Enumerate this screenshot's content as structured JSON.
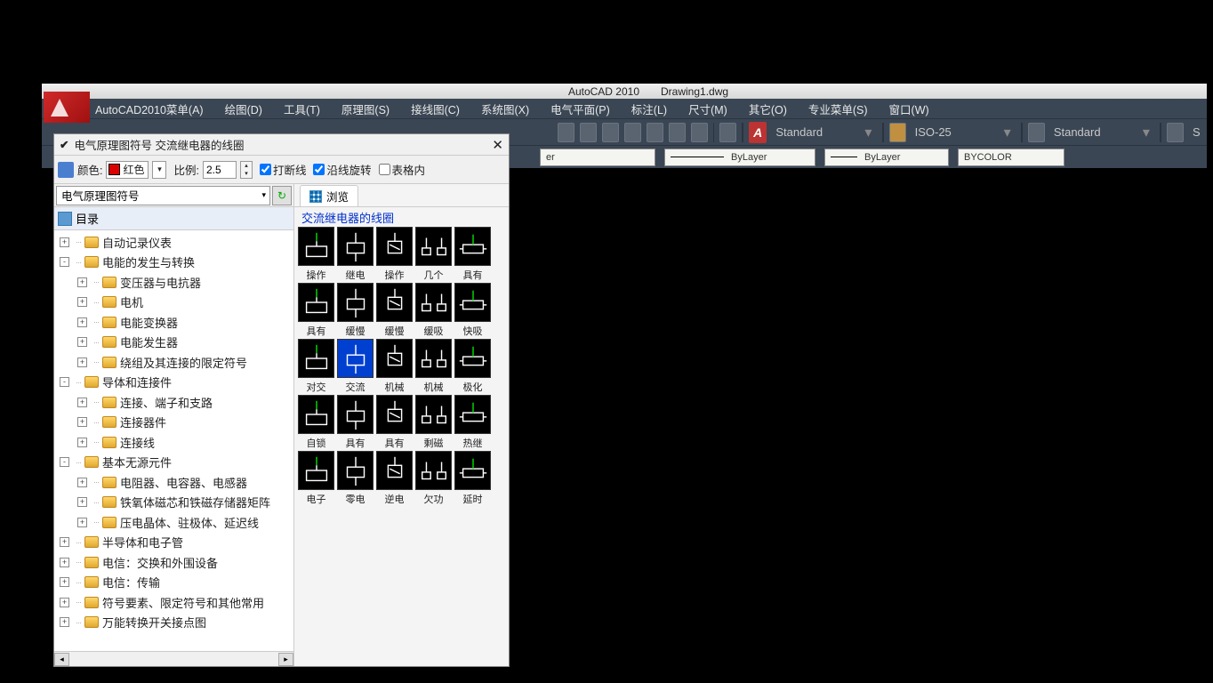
{
  "title_bar": {
    "app_name": "AutoCAD 2010",
    "file_name": "Drawing1.dwg"
  },
  "menu": {
    "m0": "AutoCAD2010菜单(A)",
    "m1": "绘图(D)",
    "m2": "工具(T)",
    "m3": "原理图(S)",
    "m4": "接线图(C)",
    "m5": "系统图(X)",
    "m6": "电气平面(P)",
    "m7": "标注(L)",
    "m8": "尺寸(M)",
    "m9": "其它(O)",
    "m10": "专业菜单(S)",
    "m11": "窗口(W)"
  },
  "ribbon": {
    "annot_letter": "A",
    "style1": "Standard",
    "style2": "ISO-25",
    "style3": "Standard",
    "style4": "S",
    "prop1_suffix": "er",
    "prop2": "ByLayer",
    "prop3": "ByLayer",
    "prop4": "BYCOLOR"
  },
  "panel": {
    "title": "电气原理图符号 交流继电器的线圈",
    "color_label": "颜色:",
    "color_text": "红色",
    "scale_label": "比例:",
    "scale_value": "2.5",
    "chk1": "打断线",
    "chk2": "沿线旋转",
    "chk3": "表格内",
    "combo": "电气原理图符号",
    "root": "目录",
    "tab_browse": "浏览",
    "preview_title": "交流继电器的线圈"
  },
  "tree": [
    {
      "depth": 1,
      "exp": "+",
      "label": "自动记录仪表"
    },
    {
      "depth": 1,
      "exp": "-",
      "label": "电能的发生与转换"
    },
    {
      "depth": 2,
      "exp": "+",
      "label": "变压器与电抗器"
    },
    {
      "depth": 2,
      "exp": "+",
      "label": "电机"
    },
    {
      "depth": 2,
      "exp": "+",
      "label": "电能变换器"
    },
    {
      "depth": 2,
      "exp": "+",
      "label": "电能发生器"
    },
    {
      "depth": 2,
      "exp": "+",
      "label": "绕组及其连接的限定符号"
    },
    {
      "depth": 1,
      "exp": "-",
      "label": "导体和连接件"
    },
    {
      "depth": 2,
      "exp": "+",
      "label": "连接、端子和支路"
    },
    {
      "depth": 2,
      "exp": "+",
      "label": "连接器件"
    },
    {
      "depth": 2,
      "exp": "+",
      "label": "连接线"
    },
    {
      "depth": 1,
      "exp": "-",
      "label": "基本无源元件"
    },
    {
      "depth": 2,
      "exp": "+",
      "label": "电阻器、电容器、电感器"
    },
    {
      "depth": 2,
      "exp": "+",
      "label": "铁氧体磁芯和铁磁存储器矩阵"
    },
    {
      "depth": 2,
      "exp": "+",
      "label": "压电晶体、驻极体、延迟线"
    },
    {
      "depth": 1,
      "exp": "+",
      "label": "半导体和电子管"
    },
    {
      "depth": 1,
      "exp": "+",
      "label": "电信：交换和外围设备"
    },
    {
      "depth": 1,
      "exp": "+",
      "label": "电信：传输"
    },
    {
      "depth": 1,
      "exp": "+",
      "label": "符号要素、限定符号和其他常用"
    },
    {
      "depth": 1,
      "exp": "+",
      "label": "万能转换开关接点图"
    }
  ],
  "symbols": [
    [
      {
        "l": "操作",
        "s": 0
      },
      {
        "l": "继电",
        "s": 0
      },
      {
        "l": "操作",
        "s": 0
      },
      {
        "l": "几个",
        "s": 0
      },
      {
        "l": "具有",
        "s": 0
      }
    ],
    [
      {
        "l": "具有",
        "s": 0
      },
      {
        "l": "缓慢",
        "s": 0
      },
      {
        "l": "缓慢",
        "s": 0
      },
      {
        "l": "缓吸",
        "s": 0
      },
      {
        "l": "快吸",
        "s": 0
      }
    ],
    [
      {
        "l": "对交",
        "s": 0
      },
      {
        "l": "交流",
        "s": 1
      },
      {
        "l": "机械",
        "s": 0
      },
      {
        "l": "机械",
        "s": 0
      },
      {
        "l": "极化",
        "s": 0
      }
    ],
    [
      {
        "l": "自锁",
        "s": 0
      },
      {
        "l": "具有",
        "s": 0
      },
      {
        "l": "具有",
        "s": 0
      },
      {
        "l": "剩磁",
        "s": 0
      },
      {
        "l": "热继",
        "s": 0
      }
    ],
    [
      {
        "l": "电子",
        "s": 0
      },
      {
        "l": "零电",
        "s": 0
      },
      {
        "l": "逆电",
        "s": 0
      },
      {
        "l": "欠功",
        "s": 0
      },
      {
        "l": "延时",
        "s": 0
      }
    ]
  ]
}
